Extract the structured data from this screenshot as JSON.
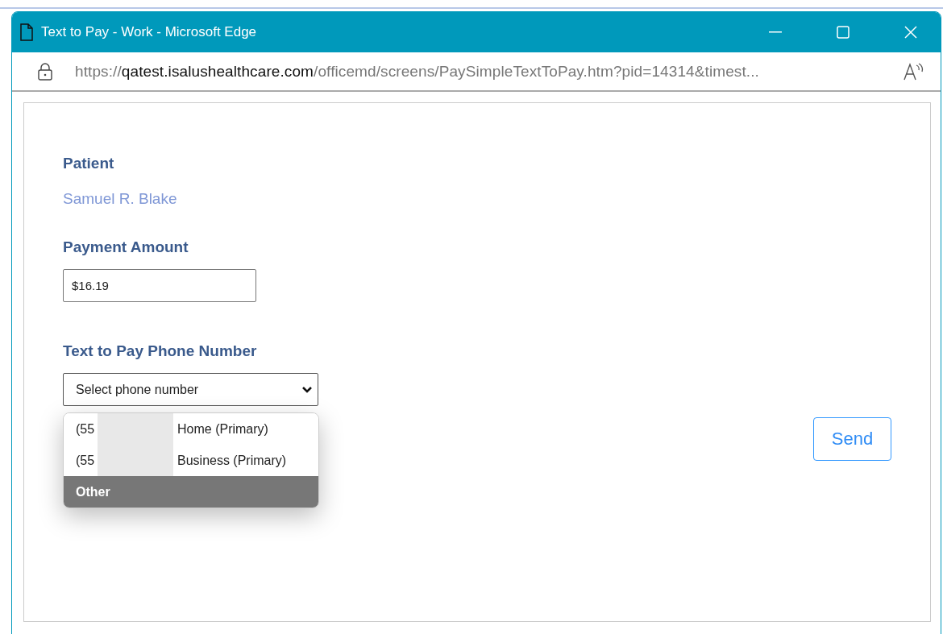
{
  "window": {
    "title": "Text to Pay - Work - Microsoft Edge"
  },
  "address_bar": {
    "scheme": "https://",
    "host": "qatest.isalushealthcare.com",
    "path": "/officemd/screens/PaySimpleTextToPay.htm?pid=14314&timest..."
  },
  "form": {
    "patient_label": "Patient",
    "patient_name": "Samuel R. Blake",
    "amount_label": "Payment Amount",
    "amount_value": "$16.19",
    "phone_label": "Text to Pay Phone Number",
    "phone_select": "Select phone number",
    "phone_options": [
      {
        "number": "(55",
        "type": "Home (Primary)",
        "selected": false
      },
      {
        "number": "(55",
        "type": "Business (Primary)",
        "selected": false
      },
      {
        "number": "Other",
        "selected": true
      }
    ],
    "send_button": "Send"
  }
}
